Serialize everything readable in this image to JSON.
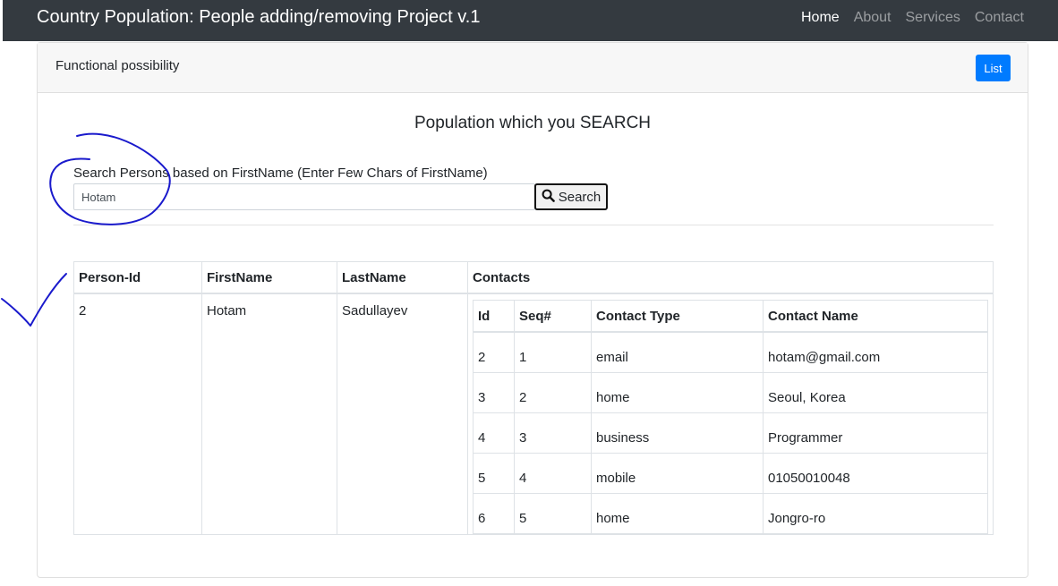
{
  "navbar": {
    "brand": "Country Population: People adding/removing Project v.1",
    "links": [
      {
        "label": "Home",
        "active": true
      },
      {
        "label": "About",
        "active": false
      },
      {
        "label": "Services",
        "active": false
      },
      {
        "label": "Contact",
        "active": false
      }
    ]
  },
  "card": {
    "title": "Functional possibility",
    "list_button": "List",
    "heading": "Population which you SEARCH"
  },
  "search": {
    "label": "Search Persons based on FirstName (Enter Few Chars of FirstName)",
    "value": "Hotam",
    "button_label": "Search",
    "button_icon": "search-icon"
  },
  "table": {
    "headers": [
      "Person-Id",
      "FirstName",
      "LastName",
      "Contacts"
    ],
    "rows": [
      {
        "person_id": "2",
        "first_name": "Hotam",
        "last_name": "Sadullayev",
        "contacts": {
          "headers": [
            "Id",
            "Seq#",
            "Contact Type",
            "Contact Name"
          ],
          "rows": [
            [
              "2",
              "1",
              "email",
              "hotam@gmail.com"
            ],
            [
              "3",
              "2",
              "home",
              "Seoul, Korea"
            ],
            [
              "4",
              "3",
              "business",
              "Programmer"
            ],
            [
              "5",
              "4",
              "mobile",
              "01050010048"
            ],
            [
              "6",
              "5",
              "home",
              "Jongro-ro"
            ]
          ]
        }
      }
    ]
  },
  "colors": {
    "navbar_bg": "#343a40",
    "primary": "#007bff",
    "annotation_ink": "#1a1acc"
  }
}
